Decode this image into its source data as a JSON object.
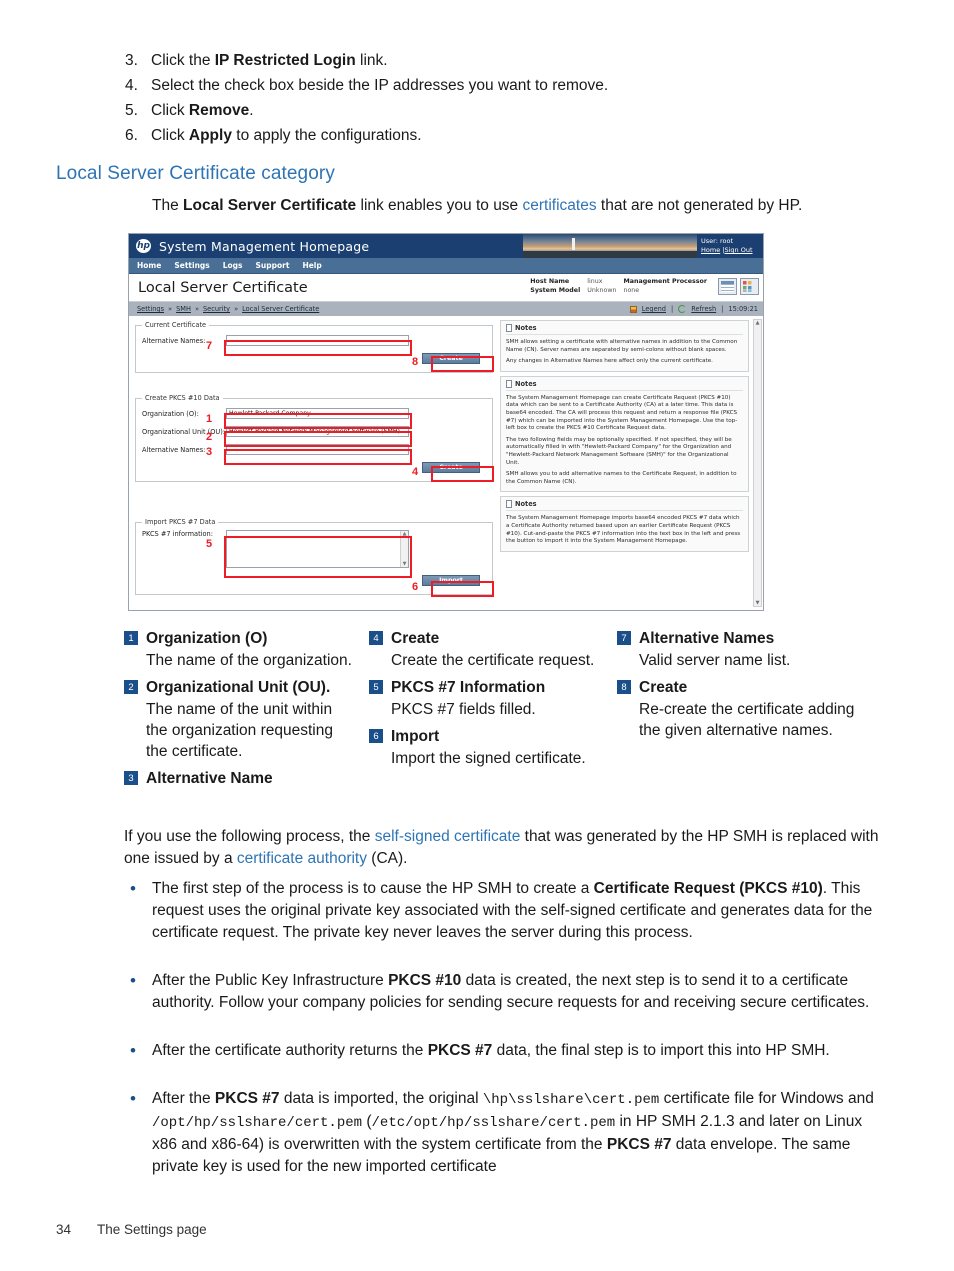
{
  "steps": [
    {
      "n": "3.",
      "parts": [
        {
          "t": "Click the ",
          "b": false
        },
        {
          "t": "IP Restricted Login",
          "b": true
        },
        {
          "t": " link.",
          "b": false
        }
      ]
    },
    {
      "n": "4.",
      "parts": [
        {
          "t": "Select the check box beside the IP addresses you want to remove.",
          "b": false
        }
      ]
    },
    {
      "n": "5.",
      "parts": [
        {
          "t": "Click ",
          "b": false
        },
        {
          "t": "Remove",
          "b": true
        },
        {
          "t": ".",
          "b": false
        }
      ]
    },
    {
      "n": "6.",
      "parts": [
        {
          "t": "Click ",
          "b": false
        },
        {
          "t": "Apply",
          "b": true
        },
        {
          "t": " to apply the configurations.",
          "b": false
        }
      ]
    }
  ],
  "section_heading": "Local Server Certificate category",
  "intro": {
    "p1": "The ",
    "bold": "Local Server Certificate",
    "p2": " link enables you to use ",
    "link": "certificates",
    "p3": " that are not generated by HP."
  },
  "screenshot": {
    "app_title": "System Management Homepage",
    "logo_text": "hp",
    "user_label": "User: root",
    "user_home": "Home",
    "user_signout": "Sign Out",
    "nav": [
      "Home",
      "Settings",
      "Logs",
      "Support",
      "Help"
    ],
    "page_title": "Local Server Certificate",
    "hostinfo": [
      {
        "label": "Host Name",
        "value": "linux"
      },
      {
        "label": "System Model",
        "value": "Unknown"
      },
      {
        "label": "Management Processor",
        "value": "none"
      }
    ],
    "breadcrumb": [
      "Settings",
      "SMH",
      "Security",
      "Local Server Certificate"
    ],
    "legend_link": "Legend",
    "refresh_link": "Refresh",
    "timestamp": "15:09:21",
    "panes": {
      "current_cert": {
        "legend": "Current Certificate",
        "alt_names_label": "Alternative Names:",
        "alt_names_value": "",
        "create_button": "Create",
        "marker_field": "7",
        "marker_button": "8"
      },
      "create_pkcs10": {
        "legend": "Create PKCS #10 Data",
        "org_label": "Organization (O):",
        "org_value": "Hewlett-Packard Company",
        "ou_label": "Organizational Unit (OU):",
        "ou_value": "Hewlett-Packard Network Management Software (SMH)",
        "alt_label": "Alternative Names:",
        "alt_value": "",
        "create_button": "Create",
        "marker_org": "1",
        "marker_ou": "2",
        "marker_alt": "3",
        "marker_button": "4"
      },
      "import_pkcs7": {
        "legend": "Import PKCS #7 Data",
        "info_label": "PKCS #7 information:",
        "info_value": "",
        "import_button": "Import",
        "marker_field": "5",
        "marker_button": "6"
      }
    },
    "notes": {
      "title": "Notes",
      "note1_p1": "SMH allows setting a certificate with alternative names in addition to the Common Name (CN). Server names are separated by semi-colons without blank spaces.",
      "note1_p2": "Any changes in Alternative Names here affect only the current certificate.",
      "note2_p1": "The System Management Homepage can create Certificate Request (PKCS #10) data which can be sent to a Certificate Authority (CA) at a later time. This data is base64 encoded. The CA will process this request and return a response file (PKCS #7) which can be imported into the System Management Homepage. Use the top-left box to create the PKCS #10 Certificate Request data.",
      "note2_p2": "The two following fields may be optionally specified. If not specified, they will be automatically filled in with \"Hewlett-Packard Company\" for the Organization and \"Hewlett-Packard Network Management Software (SMH)\" for the Organizational Unit.",
      "note2_p3": "SMH allows you to add alternative names to the Certificate Request, in addition to the Common Name (CN).",
      "note3_p1": "The System Management Homepage imports base64 encoded PKCS #7 data which a Certificate Authority returned based upon an earlier Certificate Request (PKCS #10). Cut-and-paste the PKCS #7 information into the text box in the left and press the button to import it into the System Management Homepage."
    }
  },
  "legend_items": [
    {
      "n": "1",
      "title": "Organization (O)",
      "desc": "The name of the organization."
    },
    {
      "n": "2",
      "title": "Organizational Unit (OU).",
      "desc": "The name of the unit within the organization requesting the certificate."
    },
    {
      "n": "3",
      "title": "Alternative Name",
      "desc": ""
    },
    {
      "n": "4",
      "title": "Create",
      "desc": "Create the certificate request."
    },
    {
      "n": "5",
      "title": "PKCS #7 Information",
      "desc": "PKCS #7 fields filled."
    },
    {
      "n": "6",
      "title": "Import",
      "desc": "Import the signed certificate."
    },
    {
      "n": "7",
      "title": "Alternative Names",
      "desc": "Valid server name list."
    },
    {
      "n": "8",
      "title": "Create",
      "desc": "Re-create the certificate adding the given alternative names."
    }
  ],
  "process_para": {
    "t1": "If you use the following process, the ",
    "link1": "self-signed certificate",
    "t2": " that was generated by the HP SMH is replaced with one issued by a ",
    "link2": "certificate authority",
    "t3": " (CA)."
  },
  "bullets": [
    {
      "parts": [
        {
          "t": "The first step of the process is to cause the HP SMH to create a ",
          "s": "n"
        },
        {
          "t": "Certificate Request (PKCS #10)",
          "s": "b"
        },
        {
          "t": ". This request uses the original private key associated with the self-signed certificate and generates data for the certificate request. The private key never leaves the server during this process.",
          "s": "n"
        }
      ]
    },
    {
      "parts": [
        {
          "t": "After the Public Key Infrastructure ",
          "s": "n"
        },
        {
          "t": "PKCS #10",
          "s": "b"
        },
        {
          "t": " data is created, the next step is to send it to a certificate authority. Follow your company policies for sending secure requests for and receiving secure certificates.",
          "s": "n"
        }
      ]
    },
    {
      "parts": [
        {
          "t": "After the certificate authority returns the ",
          "s": "n"
        },
        {
          "t": "PKCS #7",
          "s": "b"
        },
        {
          "t": " data, the final step is to import this into HP SMH.",
          "s": "n"
        }
      ]
    },
    {
      "parts": [
        {
          "t": "After the ",
          "s": "n"
        },
        {
          "t": "PKCS #7",
          "s": "b"
        },
        {
          "t": " data is imported, the original ",
          "s": "n"
        },
        {
          "t": "\\hp\\sslshare\\cert.pem",
          "s": "m"
        },
        {
          "t": " certificate file for Windows and ",
          "s": "n"
        },
        {
          "t": "/opt/hp/sslshare/cert.pem",
          "s": "m"
        },
        {
          "t": " (",
          "s": "n"
        },
        {
          "t": "/etc/opt/hp/sslshare/cert.pem",
          "s": "m"
        },
        {
          "t": " in HP SMH 2.1.3 and later on Linux x86 and x86-64) is overwritten with the system certificate from the ",
          "s": "n"
        },
        {
          "t": "PKCS #7",
          "s": "b"
        },
        {
          "t": " data envelope. The same private key is used for the new imported certificate",
          "s": "n"
        }
      ]
    }
  ],
  "footer": {
    "page_number": "34",
    "label": "The Settings page"
  },
  "colors": {
    "heading_blue": "#2e74b5",
    "link_blue": "#2e74b5",
    "badge_blue": "#1b4f8a",
    "annotation_red": "#ee1c25",
    "smh_header": "#1b3f70"
  }
}
